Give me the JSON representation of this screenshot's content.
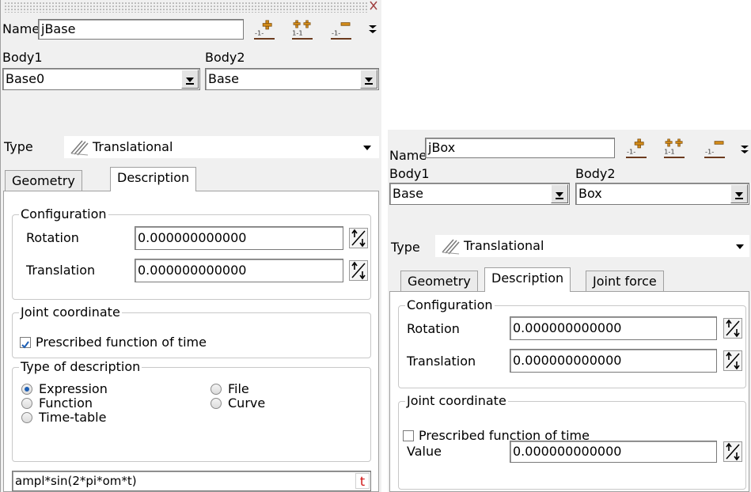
{
  "left": {
    "name_label": "Name",
    "name_value": "jBase",
    "body1_label": "Body1",
    "body2_label": "Body2",
    "body1_value": "Base0",
    "body2_value": "Base",
    "type_label": "Type",
    "type_value": "Translational",
    "tabs": [
      "Geometry",
      "Description"
    ],
    "configuration_legend": "Configuration",
    "rotation_label": "Rotation",
    "rotation_value": "0.000000000000",
    "translation_label": "Translation",
    "translation_value": "0.000000000000",
    "joint_coordinate_legend": "Joint coordinate",
    "prescribed_label": "Prescribed function of time",
    "prescribed_checked": true,
    "type_of_description_legend": "Type of description",
    "radio_options": [
      "Expression",
      "File",
      "Function",
      "Curve",
      "Time-table"
    ],
    "radio_selected": "Expression",
    "expression_value": "ampl*sin(2*pi*om*t)",
    "expression_button": "t"
  },
  "right": {
    "name_label": "Name",
    "name_value": "jBox",
    "body1_label": "Body1",
    "body2_label": "Body2",
    "body1_value": "Base",
    "body2_value": "Box",
    "type_label": "Type",
    "type_value": "Translational",
    "tabs": [
      "Geometry",
      "Description",
      "Joint force"
    ],
    "configuration_legend": "Configuration",
    "rotation_label": "Rotation",
    "rotation_value": "0.000000000000",
    "translation_label": "Translation",
    "translation_value": "0.000000000000",
    "joint_coordinate_legend": "Joint coordinate",
    "prescribed_label": "Prescribed function of time",
    "prescribed_checked": false,
    "value_label": "Value",
    "value_value": "0.000000000000"
  },
  "colors": {
    "panel_bg": "#f0f0f0",
    "selection_blue": "#1e5fb4",
    "joint_icon_orange": "#d08a1a",
    "joint_icon_underline": "#6b3a1e",
    "expression_t_red": "#d01010"
  },
  "icons": {
    "add_joint": "add-joint-icon",
    "add_two_joints": "add-two-joints-icon",
    "remove_joint": "remove-joint-icon",
    "overflow": "overflow-arrow-icon",
    "translational": "translational-joint-icon",
    "spin": "spin-arrows-icon"
  }
}
